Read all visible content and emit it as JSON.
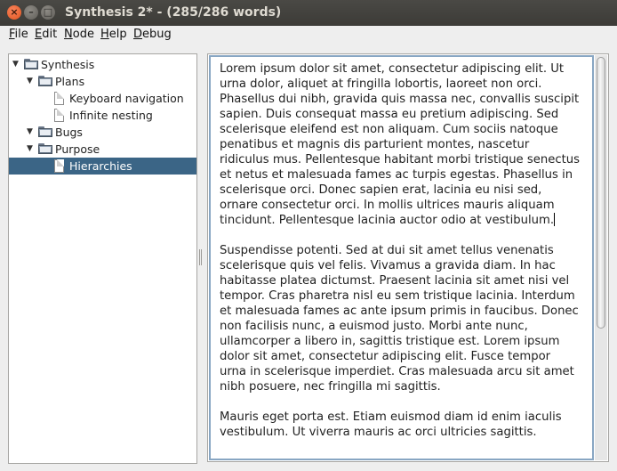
{
  "window": {
    "title": "Synthesis 2* - (285/286 words)",
    "controls": {
      "close": "×",
      "minimize": "–",
      "maximize": "□"
    }
  },
  "menubar": {
    "items": [
      {
        "mnemonic": "F",
        "rest": "ile"
      },
      {
        "mnemonic": "E",
        "rest": "dit"
      },
      {
        "mnemonic": "N",
        "rest": "ode"
      },
      {
        "mnemonic": "H",
        "rest": "elp"
      },
      {
        "mnemonic": "D",
        "rest": "ebug"
      }
    ]
  },
  "tree": {
    "expanded_glyph": "▼",
    "nodes": [
      {
        "label": "Synthesis",
        "type": "folder",
        "expanded": true,
        "depth": 0
      },
      {
        "label": "Plans",
        "type": "folder",
        "expanded": true,
        "depth": 1
      },
      {
        "label": "Keyboard navigation",
        "type": "document",
        "depth": 2
      },
      {
        "label": "Infinite nesting",
        "type": "document",
        "depth": 2
      },
      {
        "label": "Bugs",
        "type": "folder",
        "expanded": true,
        "depth": 1
      },
      {
        "label": "Purpose",
        "type": "folder",
        "expanded": true,
        "depth": 1
      },
      {
        "label": "Hierarchies",
        "type": "document",
        "depth": 2,
        "selected": true
      }
    ]
  },
  "editor": {
    "paragraphs": [
      "Lorem ipsum dolor sit amet, consectetur adipiscing elit. Ut urna dolor, aliquet at fringilla lobortis, laoreet non orci. Phasellus dui nibh, gravida quis massa nec, convallis suscipit sapien. Duis consequat massa eu pretium adipiscing. Sed scelerisque eleifend est non aliquam. Cum sociis natoque penatibus et magnis dis parturient montes, nascetur ridiculus mus. Pellentesque habitant morbi tristique senectus et netus et malesuada fames ac turpis egestas. Phasellus in scelerisque orci. Donec sapien erat, lacinia eu nisi sed, ornare consectetur orci. In mollis ultrices mauris aliquam tincidunt. Pellentesque lacinia auctor odio at vestibulum.",
      "Suspendisse potenti. Sed at dui sit amet tellus venenatis scelerisque quis vel felis. Vivamus a gravida diam. In hac habitasse platea dictumst. Praesent lacinia sit amet nisi vel tempor. Cras pharetra nisl eu sem tristique lacinia. Interdum et malesuada fames ac ante ipsum primis in faucibus. Donec non facilisis nunc, a euismod justo. Morbi ante nunc, ullamcorper a libero in, sagittis tristique est. Lorem ipsum dolor sit amet, consectetur adipiscing elit. Fusce tempor urna in scelerisque imperdiet. Cras malesuada arcu sit amet nibh posuere, nec fringilla mi sagittis.",
      "Mauris eget porta est. Etiam euismod diam id enim iaculis vestibulum. Ut viverra mauris ac orci ultricies sagittis."
    ]
  },
  "colors": {
    "selection": "#3b6586",
    "titlebar": "#3c3b37",
    "focus_border": "#88a6c3"
  }
}
